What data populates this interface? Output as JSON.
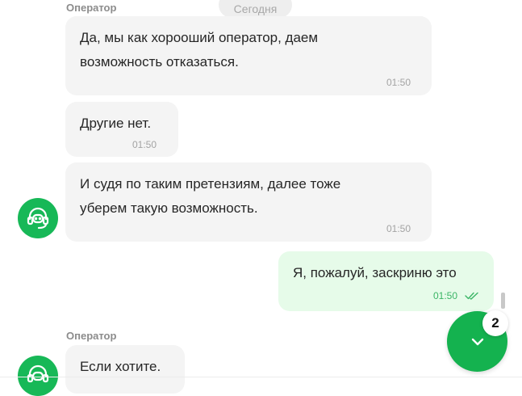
{
  "chat": {
    "date_label": "Сегодня",
    "messages": [
      {
        "sender": "Оператор",
        "text_lines": [
          "Да, мы как хорооший оператор, даем",
          "возможность отказаться."
        ],
        "time": "01:50"
      },
      {
        "text_lines": [
          "Другие нет."
        ],
        "time": "01:50"
      },
      {
        "text_lines": [
          "И судя по таким претензиям, далее тоже",
          "уберем такую возможность."
        ],
        "time": "01:50"
      },
      {
        "text_lines": [
          "Я, пожалуй, заскриню это"
        ],
        "time": "01:50",
        "status": "read"
      },
      {
        "sender": "Оператор",
        "text_lines": [
          "Если хотите."
        ]
      }
    ]
  },
  "scroll_button": {
    "unread_count": "2",
    "icon": "chevron-down-icon"
  },
  "avatar_icon": "headset-icon",
  "read_receipt_icon": "double-check-icon",
  "colors": {
    "accent": "#14b24f",
    "incoming_bubble": "#f4f4f4",
    "outgoing_bubble": "#e6fbe9",
    "time_outgoing": "#3bb566"
  }
}
